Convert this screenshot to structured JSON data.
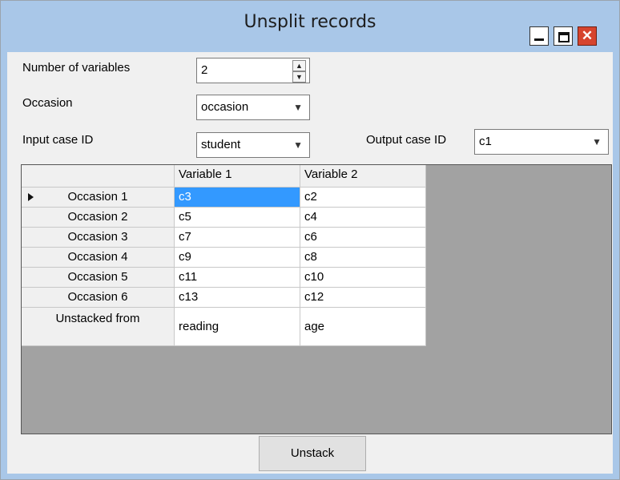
{
  "window": {
    "title": "Unsplit records",
    "close_glyph": "✕"
  },
  "form": {
    "num_vars_label": "Number of variables",
    "num_vars_value": "2",
    "occasion_label": "Occasion",
    "occasion_value": "occasion",
    "input_case_label": "Input case ID",
    "input_case_value": "student",
    "output_case_label": "Output case ID",
    "output_case_value": "c1"
  },
  "grid": {
    "col_headers": [
      "Variable  1",
      "Variable  2"
    ],
    "rows": [
      {
        "label": "Occasion 1",
        "values": [
          "c3",
          "c2"
        ]
      },
      {
        "label": "Occasion 2",
        "values": [
          "c5",
          "c4"
        ]
      },
      {
        "label": "Occasion 3",
        "values": [
          "c7",
          "c6"
        ]
      },
      {
        "label": "Occasion 4",
        "values": [
          "c9",
          "c8"
        ]
      },
      {
        "label": "Occasion 5",
        "values": [
          "c11",
          "c10"
        ]
      },
      {
        "label": "Occasion 6",
        "values": [
          "c13",
          "c12"
        ]
      },
      {
        "label": "Unstacked from",
        "values": [
          "reading",
          "age"
        ]
      }
    ]
  },
  "actions": {
    "unstack_label": "Unstack"
  }
}
